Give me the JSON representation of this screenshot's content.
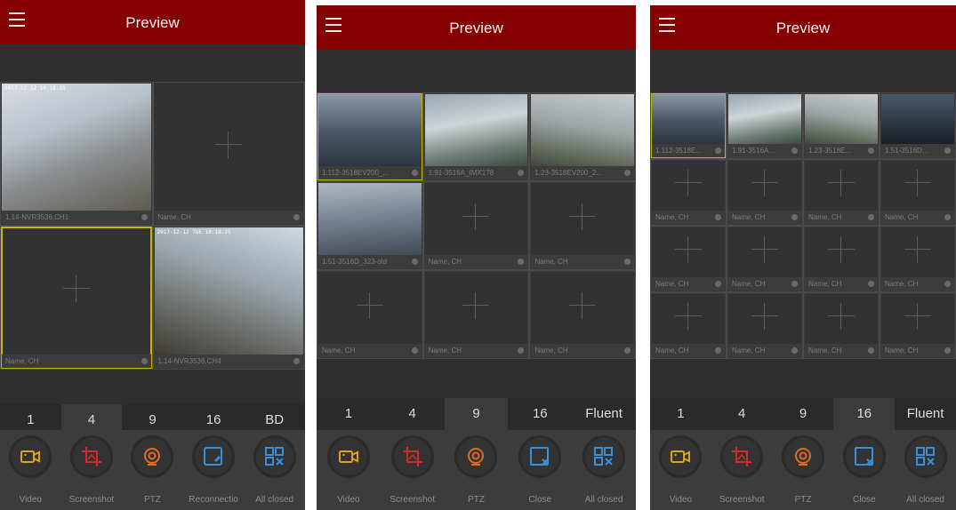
{
  "screens": [
    {
      "title": "Preview",
      "cells": [
        {
          "label": "1.14-NVR3536,CH1",
          "has_video": true,
          "selected": false,
          "image": "img-a",
          "timestamp": "2017-12-12 10:18:25"
        },
        {
          "label": "Name, CH",
          "has_video": false,
          "selected": false
        },
        {
          "label": "Name, CH",
          "has_video": false,
          "selected": true
        },
        {
          "label": "1.14-NVR3536,CH4",
          "has_video": true,
          "selected": false,
          "image": "img-b",
          "timestamp": "2017-12-12 TUE 10:18:25"
        }
      ],
      "splits": [
        "1",
        "4",
        "9",
        "16",
        "BD"
      ],
      "active_split": 1,
      "tools": [
        {
          "label": "Video",
          "icon": "video-icon"
        },
        {
          "label": "Screenshot",
          "icon": "screenshot-icon"
        },
        {
          "label": "PTZ",
          "icon": "ptz-icon"
        },
        {
          "label": "Reconnectio",
          "icon": "reconnect-icon"
        },
        {
          "label": "All closed",
          "icon": "all-closed-icon"
        }
      ]
    },
    {
      "title": "Preview",
      "cells": [
        {
          "label": "1.112-3518EV200_...",
          "has_video": true,
          "selected": true,
          "image": "img-c"
        },
        {
          "label": "1.91-3516A_IMX178",
          "has_video": true,
          "selected": false,
          "image": "img-d"
        },
        {
          "label": "1.23-3518EV200_2...",
          "has_video": true,
          "selected": false,
          "image": "img-e"
        },
        {
          "label": "1.51-3516D_323-old",
          "has_video": true,
          "selected": false,
          "image": "img-f"
        },
        {
          "label": "Name, CH",
          "has_video": false,
          "selected": false
        },
        {
          "label": "Name, CH",
          "has_video": false,
          "selected": false
        },
        {
          "label": "Name, CH",
          "has_video": false,
          "selected": false
        },
        {
          "label": "Name, CH",
          "has_video": false,
          "selected": false
        },
        {
          "label": "Name, CH",
          "has_video": false,
          "selected": false
        }
      ],
      "splits": [
        "1",
        "4",
        "9",
        "16",
        "Fluent"
      ],
      "active_split": 2,
      "tools": [
        {
          "label": "Video",
          "icon": "video-icon"
        },
        {
          "label": "Screenshot",
          "icon": "screenshot-icon"
        },
        {
          "label": "PTZ",
          "icon": "ptz-icon"
        },
        {
          "label": "Close",
          "icon": "close-icon"
        },
        {
          "label": "All closed",
          "icon": "all-closed-icon"
        }
      ]
    },
    {
      "title": "Preview",
      "cells": [
        {
          "label": "1.112-3518E...",
          "has_video": true,
          "selected": true,
          "image": "img-c"
        },
        {
          "label": "1.91-3516A...",
          "has_video": true,
          "selected": false,
          "image": "img-d"
        },
        {
          "label": "1.23-3518E...",
          "has_video": true,
          "selected": false,
          "image": "img-e"
        },
        {
          "label": "1.51-3516D...",
          "has_video": true,
          "selected": false,
          "image": "img-g"
        },
        {
          "label": "Name, CH",
          "has_video": false,
          "selected": false
        },
        {
          "label": "Name, CH",
          "has_video": false,
          "selected": false
        },
        {
          "label": "Name, CH",
          "has_video": false,
          "selected": false
        },
        {
          "label": "Name, CH",
          "has_video": false,
          "selected": false
        },
        {
          "label": "Name, CH",
          "has_video": false,
          "selected": false
        },
        {
          "label": "Name, CH",
          "has_video": false,
          "selected": false
        },
        {
          "label": "Name, CH",
          "has_video": false,
          "selected": false
        },
        {
          "label": "Name, CH",
          "has_video": false,
          "selected": false
        },
        {
          "label": "Name, CH",
          "has_video": false,
          "selected": false
        },
        {
          "label": "Name, CH",
          "has_video": false,
          "selected": false
        },
        {
          "label": "Name, CH",
          "has_video": false,
          "selected": false
        },
        {
          "label": "Name, CH",
          "has_video": false,
          "selected": false
        }
      ],
      "splits": [
        "1",
        "4",
        "9",
        "16",
        "Fluent"
      ],
      "active_split": 3,
      "tools": [
        {
          "label": "Video",
          "icon": "video-icon"
        },
        {
          "label": "Screenshot",
          "icon": "screenshot-icon"
        },
        {
          "label": "PTZ",
          "icon": "ptz-icon"
        },
        {
          "label": "Close",
          "icon": "close-icon"
        },
        {
          "label": "All closed",
          "icon": "all-closed-icon"
        }
      ]
    }
  ],
  "colors": {
    "titlebar": "#850000",
    "selection": "#c9b400",
    "video_icon": "#e0a21a",
    "screenshot_icon": "#d42a2a",
    "ptz_icon": "#e06a2a",
    "blue_icon": "#3a8fd9"
  }
}
